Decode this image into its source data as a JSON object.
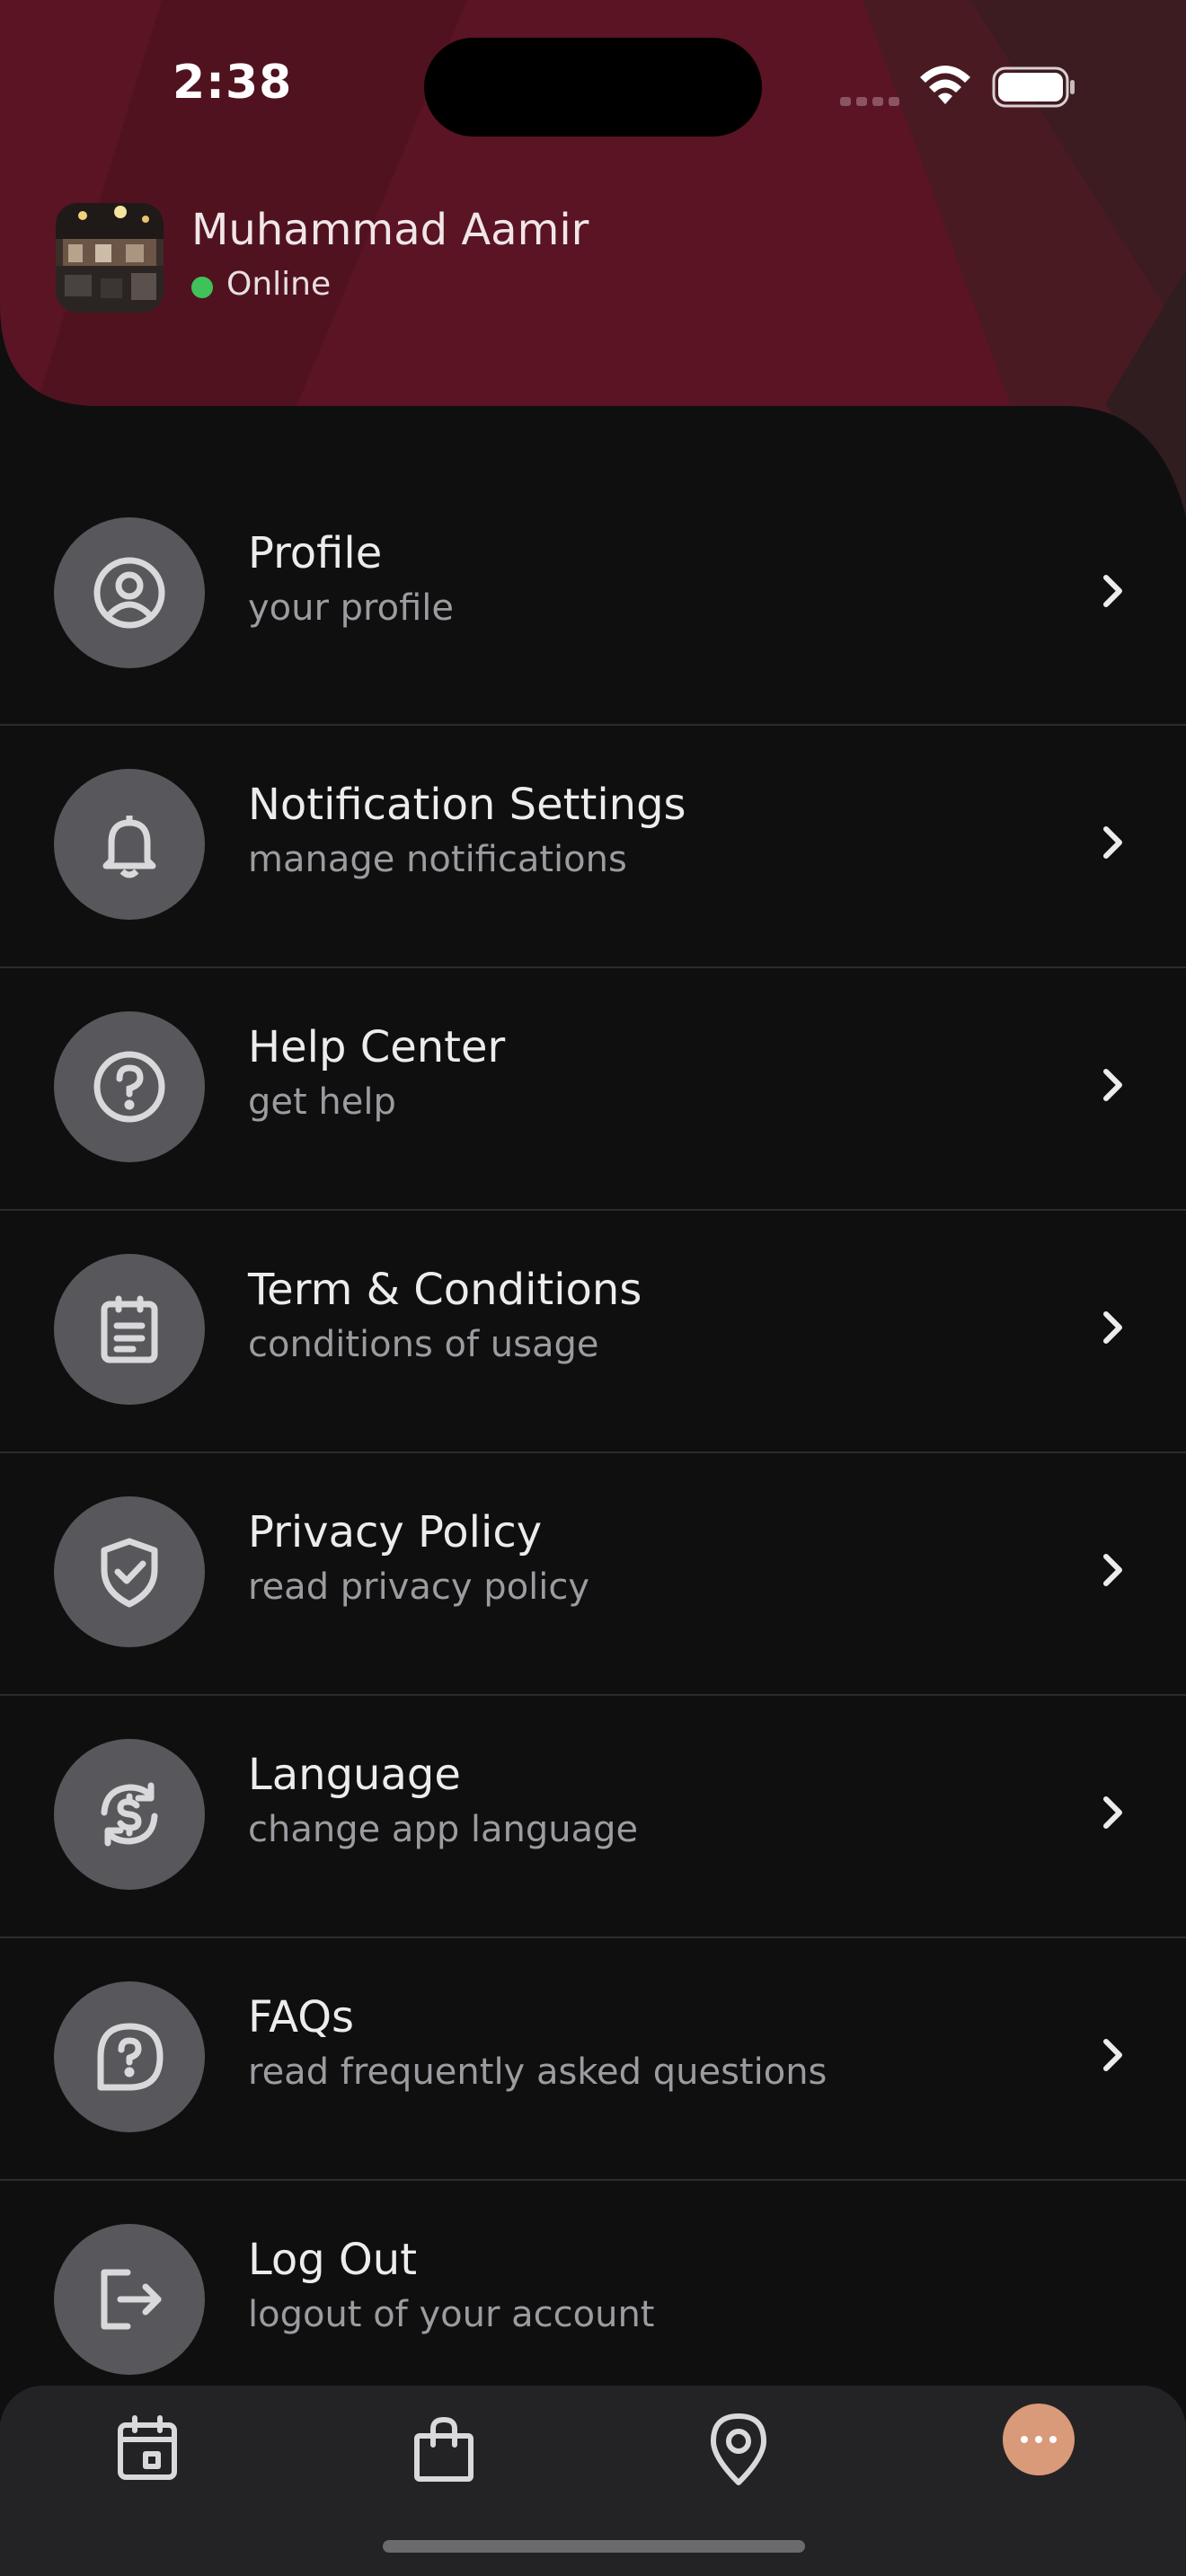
{
  "status_bar": {
    "time": "2:38"
  },
  "user": {
    "name": "Muhammad Aamir",
    "status": "Online"
  },
  "menu": [
    {
      "title": "Profile",
      "subtitle": "your profile",
      "icon": "user-circle-icon"
    },
    {
      "title": "Notification Settings",
      "subtitle": "manage notifications",
      "icon": "bell-icon"
    },
    {
      "title": "Help Center",
      "subtitle": "get help",
      "icon": "question-circle-icon"
    },
    {
      "title": "Term & Conditions",
      "subtitle": "conditions of usage",
      "icon": "clipboard-icon"
    },
    {
      "title": "Privacy Policy",
      "subtitle": "read privacy policy",
      "icon": "shield-check-icon"
    },
    {
      "title": "Language",
      "subtitle": "change app language",
      "icon": "currency-exchange-icon"
    },
    {
      "title": "FAQs",
      "subtitle": "read frequently asked questions",
      "icon": "question-chat-icon"
    },
    {
      "title": "Log Out",
      "subtitle": "logout of your account",
      "icon": "logout-icon"
    }
  ],
  "bottom_nav": [
    "calendar-icon",
    "shopping-bag-icon",
    "location-pin-icon",
    "more-icon"
  ],
  "colors": {
    "header": "#5a1424",
    "background": "#0f0f10",
    "accent": "#d99a79",
    "online": "#3fc25a"
  }
}
